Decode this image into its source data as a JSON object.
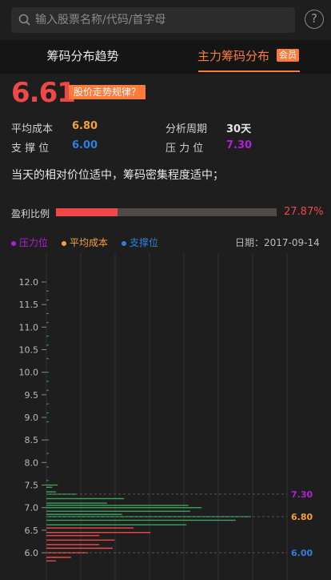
{
  "search": {
    "placeholder": "输入股票名称/代码/首字母",
    "help_label": "?"
  },
  "tabs": [
    {
      "label": "筹码分布趋势"
    },
    {
      "label": "主力筹码分布"
    }
  ],
  "vip_badge": "会员",
  "price": "6.61",
  "rule_tag": "股价走势规律？",
  "stats": {
    "avg_cost_label": "平均成本",
    "avg_cost": "6.80",
    "period_label": "分析周期",
    "period": "30天",
    "support_label": "支 撑 位",
    "support": "6.00",
    "pressure_label": "压 力 位",
    "pressure": "7.30"
  },
  "summary": "当天的相对价位适中，筹码密集程度适中；",
  "profit": {
    "label": "盈利比例",
    "value_text": "27.87%",
    "ratio": 0.2787
  },
  "legend": [
    {
      "label": "压力位",
      "color": "#b020d8"
    },
    {
      "label": "平均成本",
      "color": "#f5a13a"
    },
    {
      "label": "支撑位",
      "color": "#2f7fe0"
    }
  ],
  "date_label": "日期：2017-09-14",
  "colors": {
    "accent": "#ff7b3c",
    "up": "#f04848",
    "down": "#3aa35a",
    "pressure": "#b020d8",
    "avg": "#f5a13a",
    "support": "#2f7fe0"
  },
  "chart_data": {
    "type": "bar",
    "orientation": "horizontal",
    "y_ticks": [
      "12.0",
      "11.5",
      "11.0",
      "10.5",
      "10.0",
      "9.5",
      "9.0",
      "8.5",
      "8.0",
      "7.5",
      "7.0",
      "6.5",
      "6.0"
    ],
    "ylim": [
      5.75,
      12.35
    ],
    "markers": [
      {
        "label": "7.30",
        "price": 7.3,
        "color": "#b020d8"
      },
      {
        "label": "6.80",
        "price": 6.8,
        "color": "#f5a13a"
      },
      {
        "label": "6.00",
        "price": 6.0,
        "color": "#2f7fe0"
      }
    ],
    "bars": [
      {
        "price": 7.5,
        "value": 0.06
      },
      {
        "price": 7.45,
        "value": 0.03
      },
      {
        "price": 7.35,
        "value": 0.05
      },
      {
        "price": 7.3,
        "value": 0.16
      },
      {
        "price": 7.2,
        "value": 0.41
      },
      {
        "price": 7.1,
        "value": 0.32
      },
      {
        "price": 7.05,
        "value": 0.75
      },
      {
        "price": 7.0,
        "value": 0.82
      },
      {
        "price": 6.92,
        "value": 0.76
      },
      {
        "price": 6.85,
        "value": 0.4
      },
      {
        "price": 6.8,
        "value": 1.08
      },
      {
        "price": 6.72,
        "value": 1.0
      },
      {
        "price": 6.62,
        "value": 0.74
      },
      {
        "price": 6.55,
        "value": 0.46
      },
      {
        "price": 6.45,
        "value": 0.55
      },
      {
        "price": 6.38,
        "value": 0.28
      },
      {
        "price": 6.28,
        "value": 0.36
      },
      {
        "price": 6.18,
        "value": 0.28
      },
      {
        "price": 6.1,
        "value": 0.35
      },
      {
        "price": 6.0,
        "value": 0.22
      },
      {
        "price": 5.9,
        "value": 0.13
      },
      {
        "price": 5.82,
        "value": 0.05
      }
    ],
    "sparse_points": [
      11.8,
      11.6,
      11.3,
      11.1,
      10.8,
      10.6,
      10.3,
      10.0,
      9.8,
      9.6,
      9.3,
      9.1,
      8.9,
      8.5,
      8.2,
      7.9,
      7.6
    ]
  }
}
